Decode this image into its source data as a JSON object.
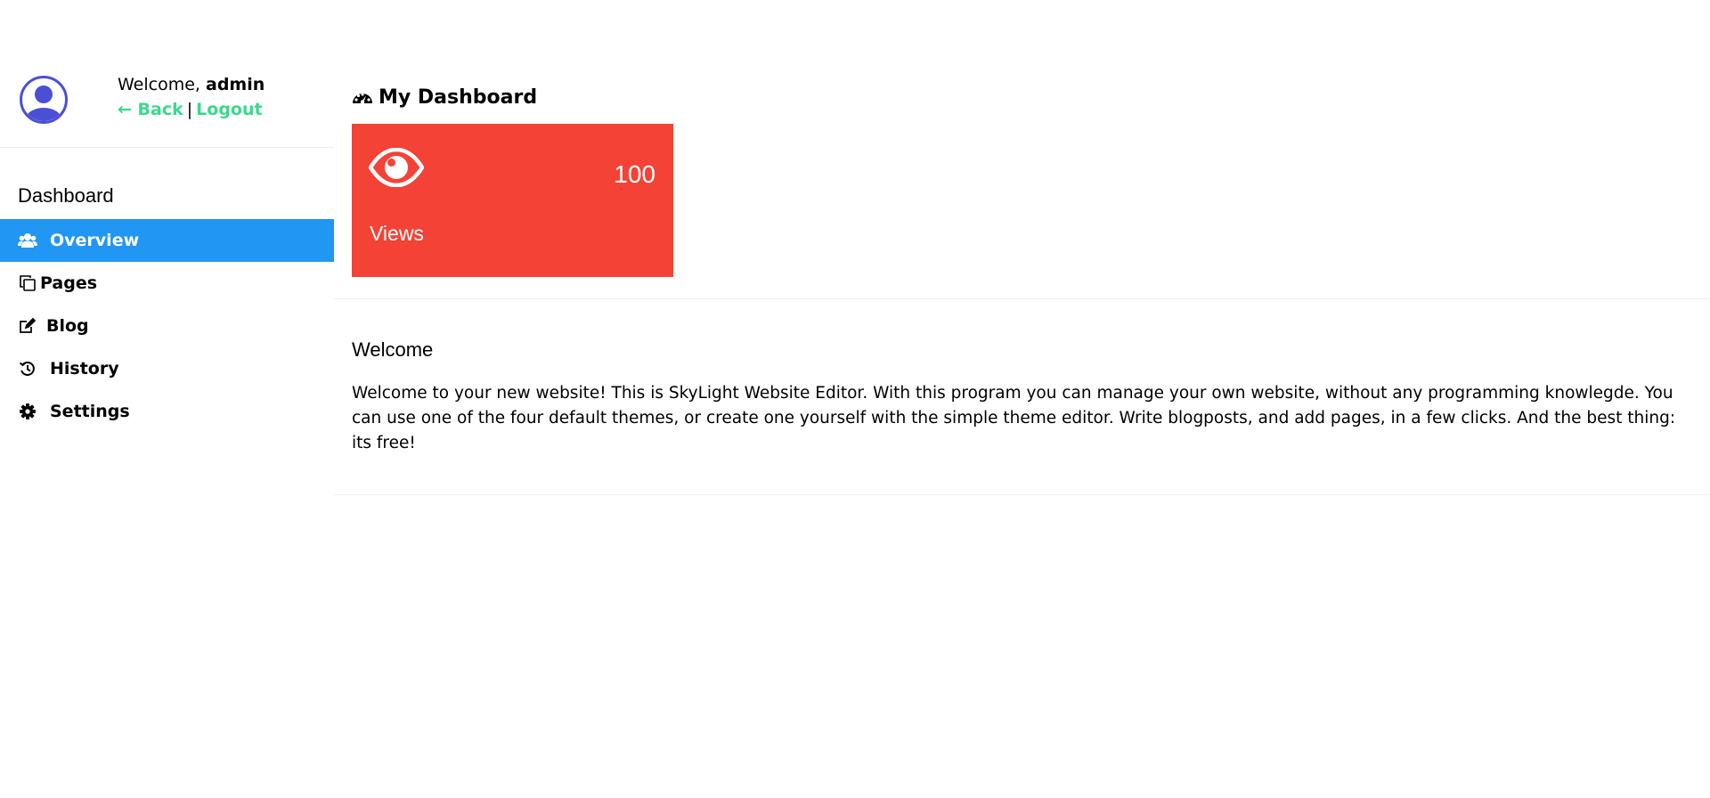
{
  "user": {
    "greeting": "Welcome,",
    "name": "admin",
    "back_label": "← Back",
    "separator": "|",
    "logout_label": "Logout"
  },
  "sidebar": {
    "title": "Dashboard",
    "items": [
      {
        "label": "Overview",
        "icon": "users-icon",
        "active": true
      },
      {
        "label": "Pages",
        "icon": "pages-icon",
        "active": false
      },
      {
        "label": "Blog",
        "icon": "edit-icon",
        "active": false
      },
      {
        "label": "History",
        "icon": "history-icon",
        "active": false
      },
      {
        "label": "Settings",
        "icon": "gear-icon",
        "active": false
      }
    ]
  },
  "main": {
    "heading": "My Dashboard",
    "views_card": {
      "count": "100",
      "label": "Views",
      "color": "#f44336"
    },
    "welcome_title": "Welcome",
    "welcome_text": "Welcome to your new website! This is SkyLight Website Editor. With this program you can manage your own website, without any programming knowlegde. You can use one of the four default themes, or create one yourself with the simple theme editor. Write blogposts, and add pages, in a few clicks. And the best thing: its free!"
  },
  "colors": {
    "accent": "#2196f3",
    "link": "#3dd88a",
    "card": "#f44336",
    "avatar": "#4a4fd6"
  }
}
